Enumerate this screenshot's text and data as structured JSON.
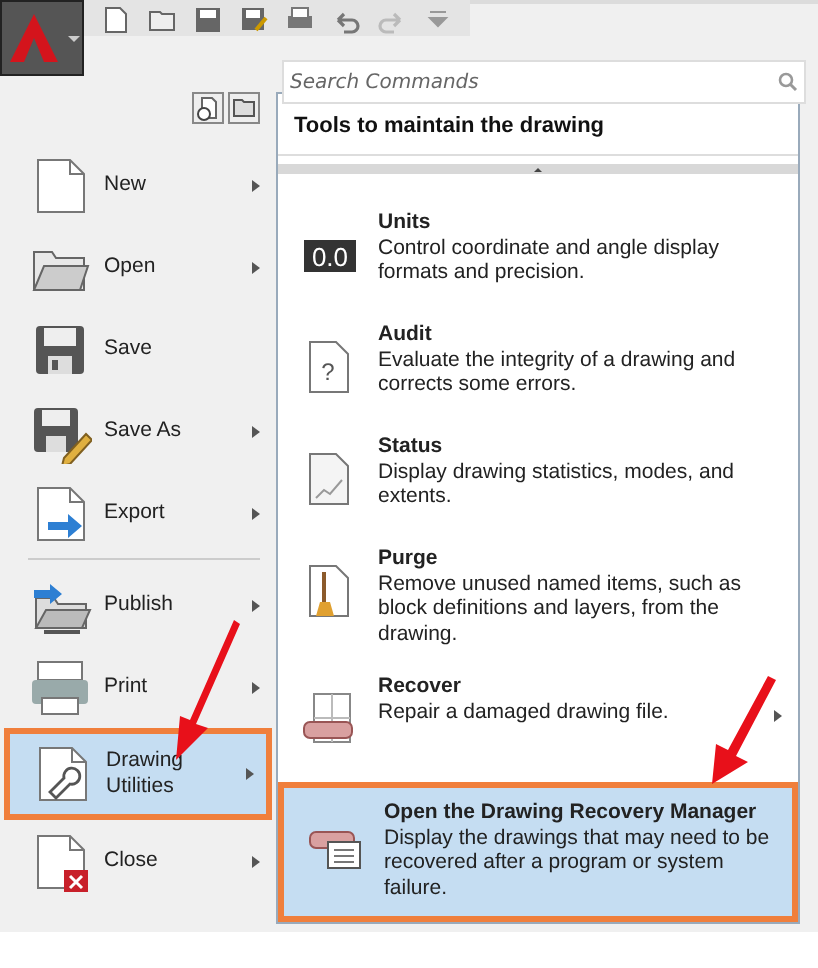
{
  "search": {
    "placeholder": "Search Commands"
  },
  "menu_items": [
    {
      "kind": "new",
      "label": "New",
      "submenu": true,
      "selected": false
    },
    {
      "kind": "open",
      "label": "Open",
      "submenu": true,
      "selected": false
    },
    {
      "kind": "save",
      "label": "Save",
      "submenu": false,
      "selected": false
    },
    {
      "kind": "saveas",
      "label": "Save As",
      "submenu": true,
      "selected": false
    },
    {
      "kind": "export",
      "label": "Export",
      "submenu": true,
      "selected": false
    },
    {
      "kind": "publish",
      "label": "Publish",
      "submenu": true,
      "selected": false
    },
    {
      "kind": "print",
      "label": "Print",
      "submenu": true,
      "selected": false
    },
    {
      "kind": "utilities",
      "label": "Drawing Utilities",
      "submenu": true,
      "selected": true
    },
    {
      "kind": "close",
      "label": "Close",
      "submenu": true,
      "selected": false
    }
  ],
  "panel": {
    "title": "Tools to maintain the drawing",
    "items": [
      {
        "kind": "units",
        "icon_text": "0.0",
        "title": "Units",
        "description": "Control coordinate and angle display formats and precision.",
        "submenu": false,
        "selected": false
      },
      {
        "kind": "audit",
        "icon_text": "?",
        "title": "Audit",
        "description": "Evaluate the integrity of a drawing and corrects some errors.",
        "submenu": false,
        "selected": false
      },
      {
        "kind": "status",
        "title": "Status",
        "description": "Display drawing statistics, modes, and extents.",
        "submenu": false,
        "selected": false
      },
      {
        "kind": "purge",
        "title": "Purge",
        "description": "Remove unused named items, such as block definitions and layers, from the drawing.",
        "submenu": false,
        "selected": false
      },
      {
        "kind": "recover",
        "title": "Recover",
        "description": "Repair a damaged drawing file.",
        "submenu": true,
        "selected": false
      },
      {
        "kind": "recovery-manager",
        "title": "Open the Drawing Recovery Manager",
        "description": "Display the drawings that may need to be recovered after a program or system failure.",
        "submenu": false,
        "selected": true
      }
    ]
  }
}
